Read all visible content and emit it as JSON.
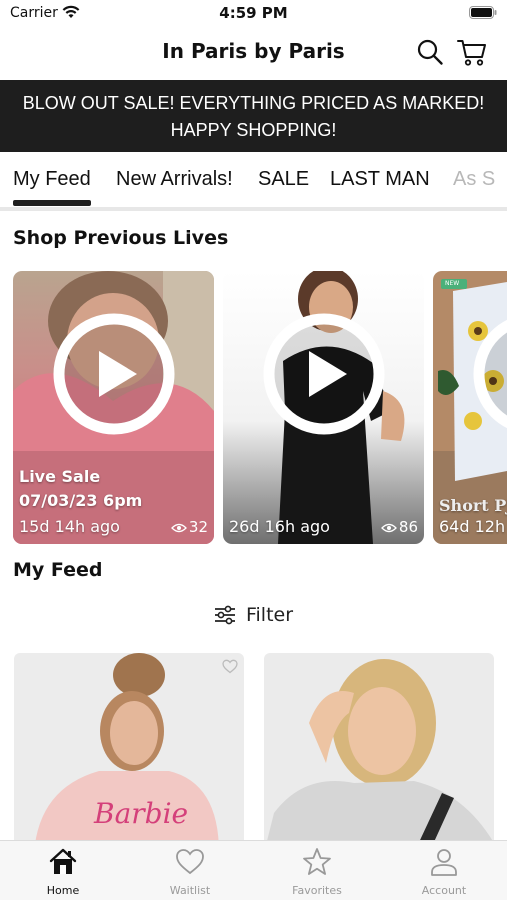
{
  "status": {
    "carrier": "Carrier",
    "time": "4:59 PM"
  },
  "header": {
    "title": "In Paris by Paris"
  },
  "banner": {
    "line1": "BLOW OUT SALE! EVERYTHING PRICED AS MARKED!",
    "line2": "HAPPY SHOPPING!"
  },
  "tabs": [
    {
      "label": "My Feed",
      "active": true
    },
    {
      "label": "New Arrivals!"
    },
    {
      "label": "SALE"
    },
    {
      "label": "LAST MAN"
    },
    {
      "label": "As S"
    }
  ],
  "lives": {
    "title": "Shop Previous Lives",
    "cards": [
      {
        "line1": "Live Sale",
        "line2": "07/03/23 6pm",
        "ago": "15d 14h ago",
        "views": "32"
      },
      {
        "line1": "",
        "line2": "",
        "ago": "26d 16h ago",
        "views": "86"
      },
      {
        "line1": "",
        "line2": "Short PJ",
        "ago": "64d 12h",
        "views": "",
        "badge": "NEW"
      }
    ]
  },
  "feed": {
    "title": "My Feed",
    "filter_label": "Filter",
    "product_text": "Barbie"
  },
  "tabbar": [
    {
      "label": "Home",
      "icon": "home-icon",
      "active": true
    },
    {
      "label": "Waitlist",
      "icon": "heart-icon"
    },
    {
      "label": "Favorites",
      "icon": "star-icon"
    },
    {
      "label": "Account",
      "icon": "person-icon"
    }
  ],
  "colors": {
    "banner_bg": "#1e1e1e",
    "accent": "#111111",
    "inactive": "#9a9a9a"
  }
}
